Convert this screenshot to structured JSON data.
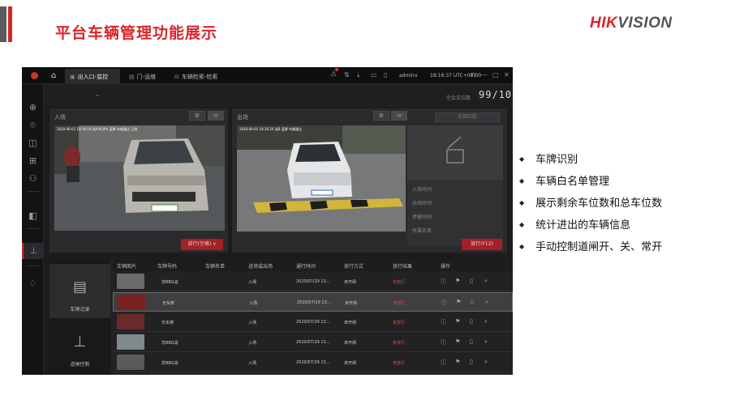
{
  "slide": {
    "title": "平台车辆管理功能展示",
    "logo_red": "HIK",
    "logo_grey": "VISION"
  },
  "app": {
    "tabs": [
      {
        "label": "出入口-监控",
        "icon": "camera"
      },
      {
        "label": "门-运维",
        "icon": "doc"
      },
      {
        "label": "车辆检索-检索",
        "icon": "car"
      }
    ],
    "user": "admin∨",
    "clock": "18:16:37 UTC+08:00",
    "remaining_label": "空余车位数",
    "remaining_value": "99/100",
    "entrance": {
      "title": "入场",
      "stamp": "2020-06-01 18:16:19 浙A5429V 蓝牌 车辆通过 正常",
      "release": "放行(空格)",
      "release_arrow": "∨"
    },
    "exit": {
      "title": "出场",
      "stamp": "2020-06-01 18:16:20 浙B 蓝牌 车辆通过",
      "release": "放行(F12)",
      "clear_btn": "车辆匹配",
      "info_rows": [
        "入场时间",
        "出场时间",
        "停留时间",
        "所属名单"
      ]
    },
    "lower_nav": [
      {
        "label": "车辆记录",
        "icon": "vehicle-record"
      },
      {
        "label": "道闸控制",
        "icon": "gate-control"
      }
    ],
    "table": {
      "headers": [
        "车辆图片",
        "车牌号码",
        "车辆名单",
        "进场或出场",
        "通行时间",
        "放行方式",
        "放行结果",
        "操作"
      ],
      "rows": [
        {
          "plate": "苏BBG渝",
          "list": "",
          "dir": "入场",
          "time": "2020/07/29 13...",
          "mode": "未开闸",
          "result": "未放行",
          "thumb": "#6b6b6b"
        },
        {
          "plate": "无车牌",
          "list": "",
          "dir": "入场",
          "time": "2020/07/29 13...",
          "mode": "未开闸",
          "result": "未放行",
          "thumb": "#7a2222"
        },
        {
          "plate": "无车牌",
          "list": "",
          "dir": "入场",
          "time": "2020/07/29 13...",
          "mode": "未开闸",
          "result": "未放行",
          "thumb": "#6a2a2a"
        },
        {
          "plate": "苏BBG渝",
          "list": "",
          "dir": "入场",
          "time": "2020/07/29 13...",
          "mode": "未开闸",
          "result": "未放行",
          "thumb": "#7e8a8e"
        },
        {
          "plate": "苏BBG渝",
          "list": "",
          "dir": "入场",
          "time": "2020/07/29 13...",
          "mode": "未开闸",
          "result": "未放行",
          "thumb": "#5a5a5a"
        }
      ]
    }
  },
  "bullets": [
    "车牌识别",
    "车辆白名单管理",
    "展示剩余车位数和总车位数",
    "统计进出的车辆信息",
    "手动控制道闸开、关、常开"
  ]
}
